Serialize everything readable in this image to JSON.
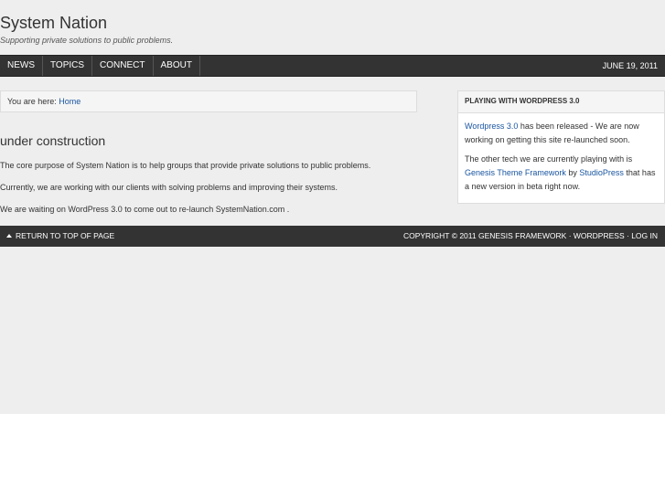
{
  "site": {
    "title": "System Nation",
    "description": "Supporting private solutions to public problems."
  },
  "nav": {
    "items": [
      {
        "label": "NEWS"
      },
      {
        "label": "TOPICS"
      },
      {
        "label": "CONNECT"
      },
      {
        "label": "ABOUT"
      }
    ],
    "date": "JUNE 19, 2011"
  },
  "breadcrumb": {
    "prefix": "You are here: ",
    "home": "Home"
  },
  "post": {
    "title": "under construction",
    "paragraphs": [
      "The core purpose of System Nation is to help groups that provide private solutions to public problems.",
      "Currently, we are working with our clients with solving problems and improving their systems.",
      "We are waiting on WordPress 3.0 to come out to re-launch SystemNation.com ."
    ]
  },
  "widget": {
    "title": "PLAYING WITH WORDPRESS 3.0",
    "p1_link": "Wordpress 3.0",
    "p1_text": " has been released - We are now working on getting this site re-launched soon.",
    "p2_text1": "The other tech we are currently playing with is ",
    "p2_link1": "Genesis Theme Framework",
    "p2_text2": " by ",
    "p2_link2": "StudioPress",
    "p2_text3": " that has a new version in beta right now."
  },
  "footer": {
    "return_top": "RETURN TO TOP OF PAGE",
    "copyright": "COPYRIGHT © 2011 GENESIS FRAMEWORK",
    "sep": " · ",
    "wordpress": "WORDPRESS",
    "login": "LOG IN"
  },
  "colors": {
    "background": "#eeeeee",
    "nav_bg": "#333333",
    "link": "#1a56a0"
  }
}
